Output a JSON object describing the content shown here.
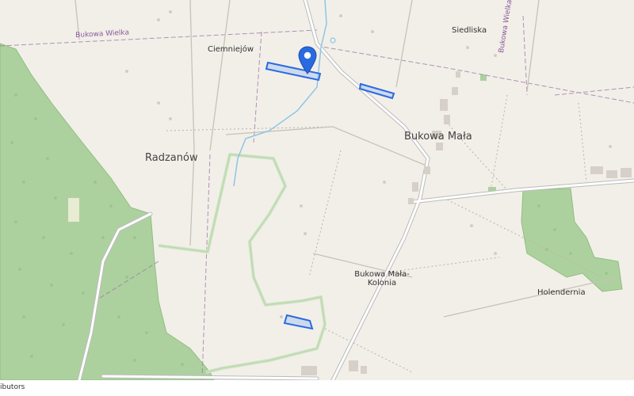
{
  "map": {
    "labels": {
      "bukowa_wielka_road": "Bukowa Wielka",
      "bukowa_wielka_road_vertical": "Bukowa Wielka",
      "ciemniejow": "Ciemniejów",
      "siedliska": "Siedliska",
      "radzanow": "Radzanów",
      "bukowa_mala": "Bukowa Mała",
      "bukowa_mala_kolonia_line1": "Bukowa Mała-",
      "bukowa_mala_kolonia_line2": "Kolonia",
      "holendernia": "Holendernia"
    },
    "marker_icon": "map-pin-icon",
    "colors": {
      "land": "#f2efe9",
      "forest": "#add19e",
      "road": "#ffffff",
      "road_casing": "#bbbbbb",
      "water": "#8ec5e6",
      "boundary": "#9e7aa8",
      "highlight": "#2a6ae0"
    }
  },
  "attribution": "ibutors"
}
